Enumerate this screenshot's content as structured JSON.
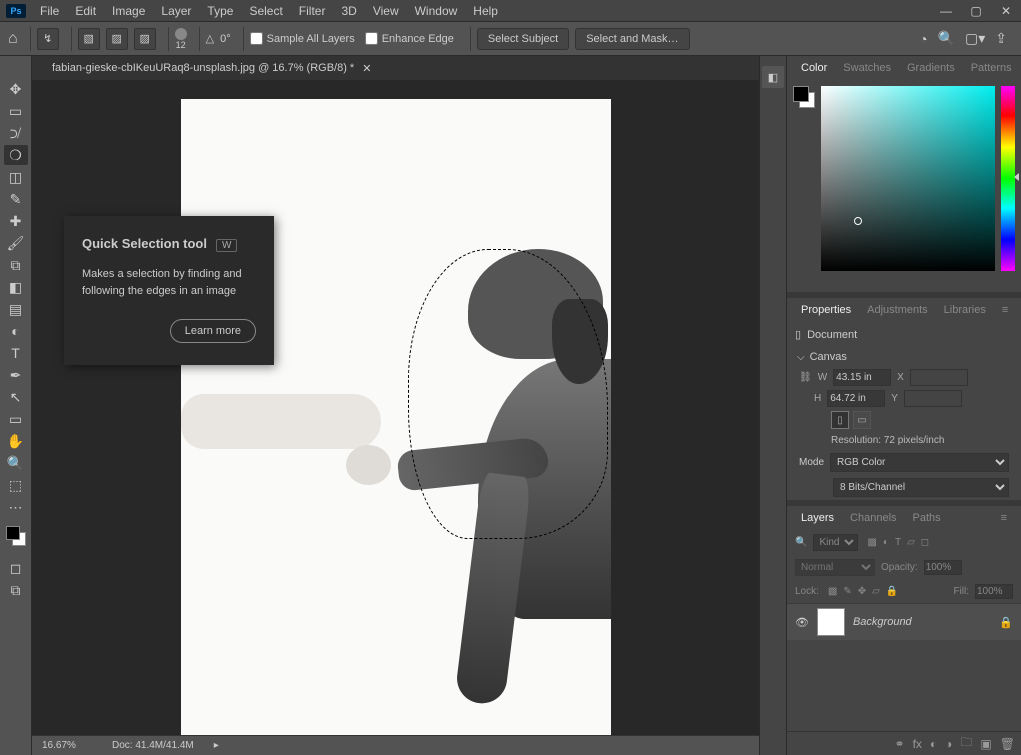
{
  "app": {
    "name": "Ps"
  },
  "menus": [
    "File",
    "Edit",
    "Image",
    "Layer",
    "Type",
    "Select",
    "Filter",
    "3D",
    "View",
    "Window",
    "Help"
  ],
  "options": {
    "angle_label": "△",
    "angle_value": "0°",
    "size_value": "12",
    "sample_all": "Sample All Layers",
    "enhance_edge": "Enhance Edge",
    "select_subject": "Select Subject",
    "select_mask": "Select and Mask…"
  },
  "doc": {
    "tab": "fabian-gieske-cbIKeuURaq8-unsplash.jpg @ 16.7% (RGB/8) *"
  },
  "tooltip": {
    "title": "Quick Selection tool",
    "key": "W",
    "desc": "Makes a selection by finding and following the edges in an image",
    "learn": "Learn more"
  },
  "color_tabs": [
    "Color",
    "Swatches",
    "Gradients",
    "Patterns"
  ],
  "prop_tabs": [
    "Properties",
    "Adjustments",
    "Libraries"
  ],
  "properties": {
    "doc_label": "Document",
    "canvas_label": "Canvas",
    "w_label": "W",
    "w_value": "43.15 in",
    "h_label": "H",
    "h_value": "64.72 in",
    "x_label": "X",
    "y_label": "Y",
    "resolution": "Resolution: 72 pixels/inch",
    "mode_label": "Mode",
    "mode_value": "RGB Color",
    "depth_value": "8 Bits/Channel"
  },
  "layer_tabs": [
    "Layers",
    "Channels",
    "Paths"
  ],
  "layers": {
    "kind_label": "Kind",
    "blend_value": "Normal",
    "opacity_label": "Opacity:",
    "opacity_value": "100%",
    "lock_label": "Lock:",
    "fill_label": "Fill:",
    "fill_value": "100%",
    "bg_name": "Background"
  },
  "status": {
    "zoom": "16.67%",
    "doc_size": "Doc: 41.4M/41.4M"
  }
}
